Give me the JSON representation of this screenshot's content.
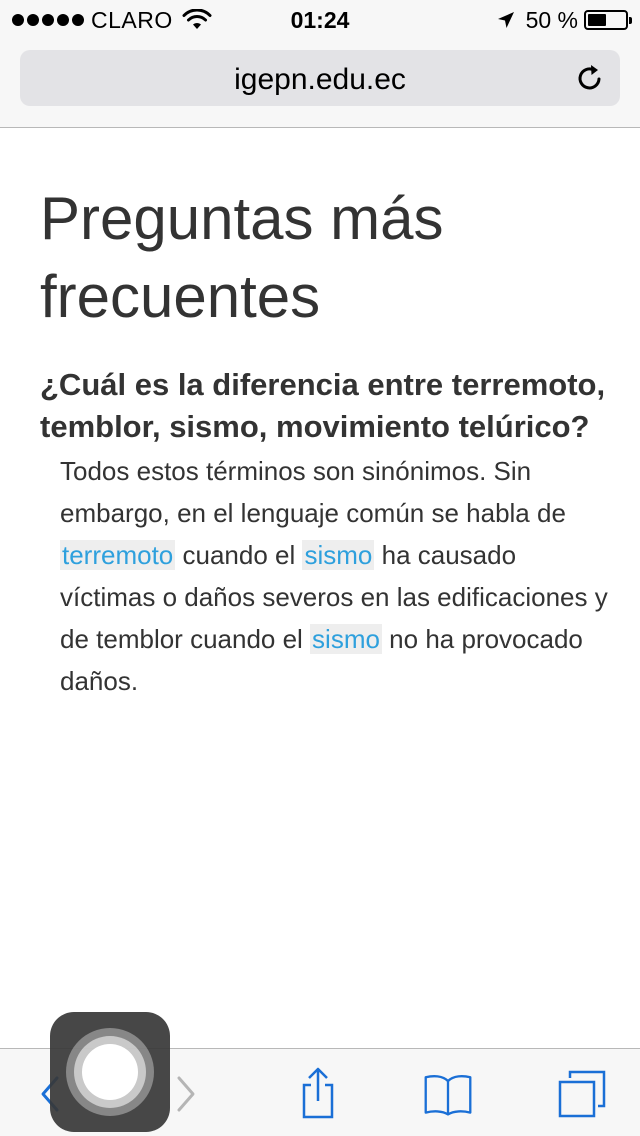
{
  "status_bar": {
    "carrier": "CLARO",
    "time": "01:24",
    "battery_percent_text": "50 %",
    "battery_level": 0.5
  },
  "address_bar": {
    "url": "igepn.edu.ec",
    "reload_icon": "reload-icon"
  },
  "page": {
    "title": "Preguntas más frecuentes",
    "question": "¿Cuál es la diferencia entre terremoto, temblor, sismo, movimiento telúrico?",
    "answer": {
      "part1": "Todos estos términos son sinónimos. Sin embargo, en el lenguaje común se habla de ",
      "link1": "terremoto",
      "part2": " cuando el ",
      "link2": "sismo",
      "part3": " ha causado víctimas o daños severos en las edificaciones y de temblor cuando el ",
      "link3": "sismo",
      "part4": " no ha provocado daños."
    },
    "link_color": "#2ea0dd"
  },
  "toolbar": {
    "icons": [
      "back-icon",
      "forward-icon",
      "share-icon",
      "bookmarks-icon",
      "tabs-icon"
    ],
    "accent_color": "#1a6fd6"
  },
  "assistive_touch": {
    "icon": "assistive-touch-icon"
  }
}
